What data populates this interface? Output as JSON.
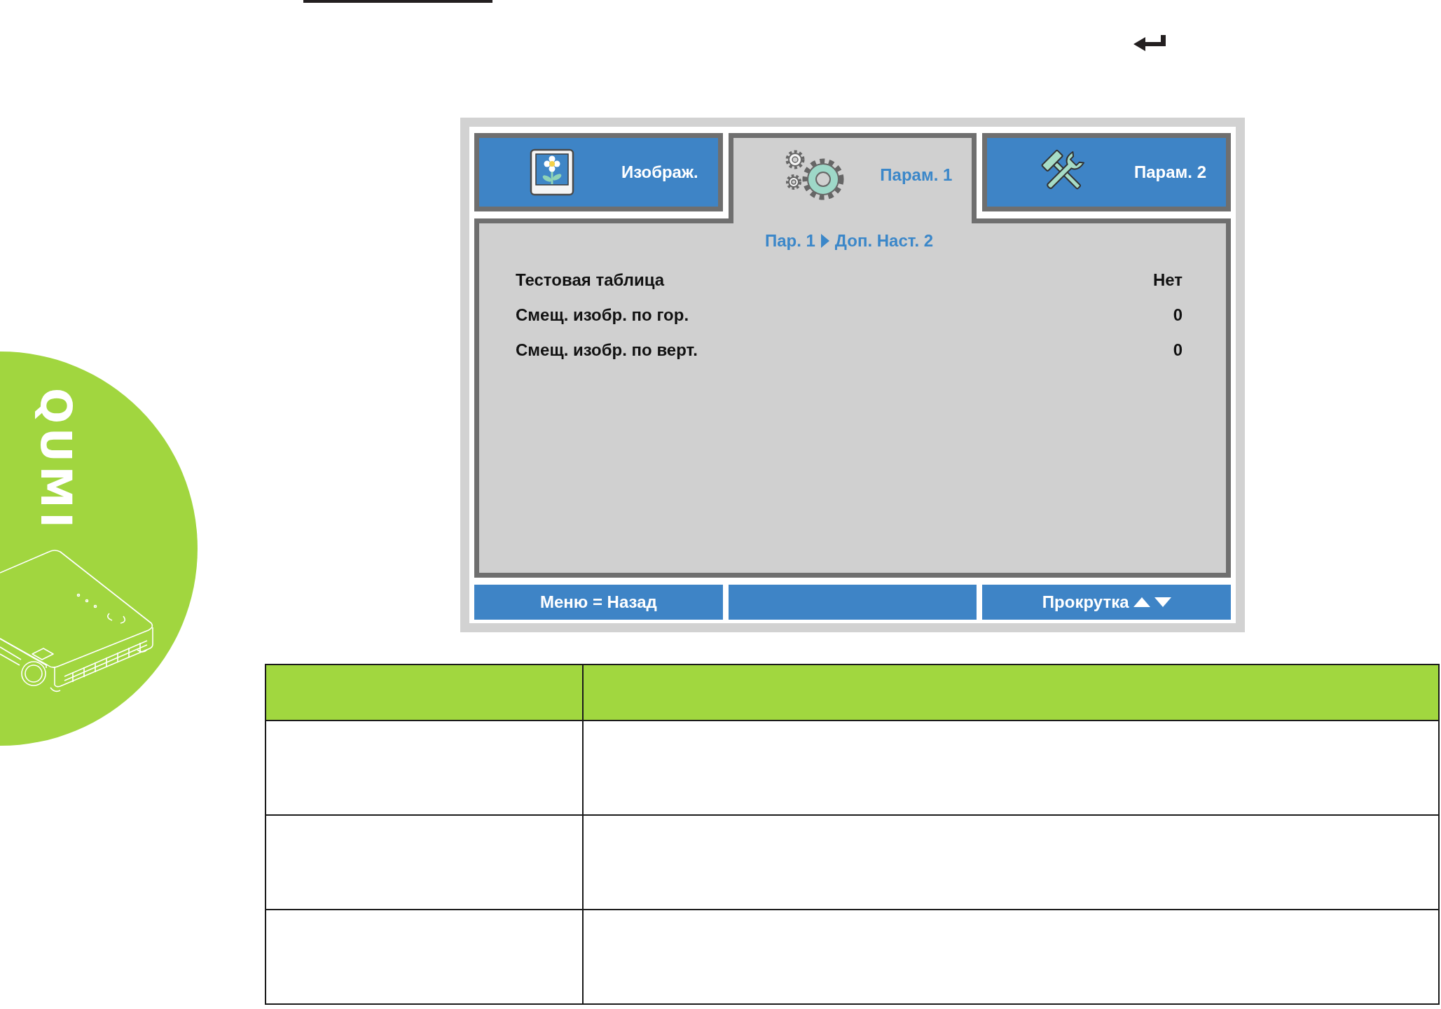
{
  "logo": {
    "text": "QUMI"
  },
  "osd_menu": {
    "tabs": [
      {
        "kind": "image",
        "label": "Изображ.",
        "selected": false
      },
      {
        "kind": "settings",
        "label": "Парам. 1",
        "selected": true
      },
      {
        "kind": "tools",
        "label": "Парам. 2",
        "selected": false
      }
    ],
    "breadcrumb": {
      "parent": "Пар. 1",
      "current": "Доп. Наст. 2"
    },
    "items": [
      {
        "label": "Тестовая таблица",
        "value": "Нет"
      },
      {
        "label": "Смещ. изобр. по гор.",
        "value": "0"
      },
      {
        "label": "Смещ. изобр. по верт.",
        "value": "0"
      }
    ],
    "footer": [
      {
        "kind": "hint",
        "label": "Меню = Назад"
      },
      {
        "kind": "blank"
      },
      {
        "kind": "scroll",
        "label": "Прокрутка"
      }
    ]
  }
}
